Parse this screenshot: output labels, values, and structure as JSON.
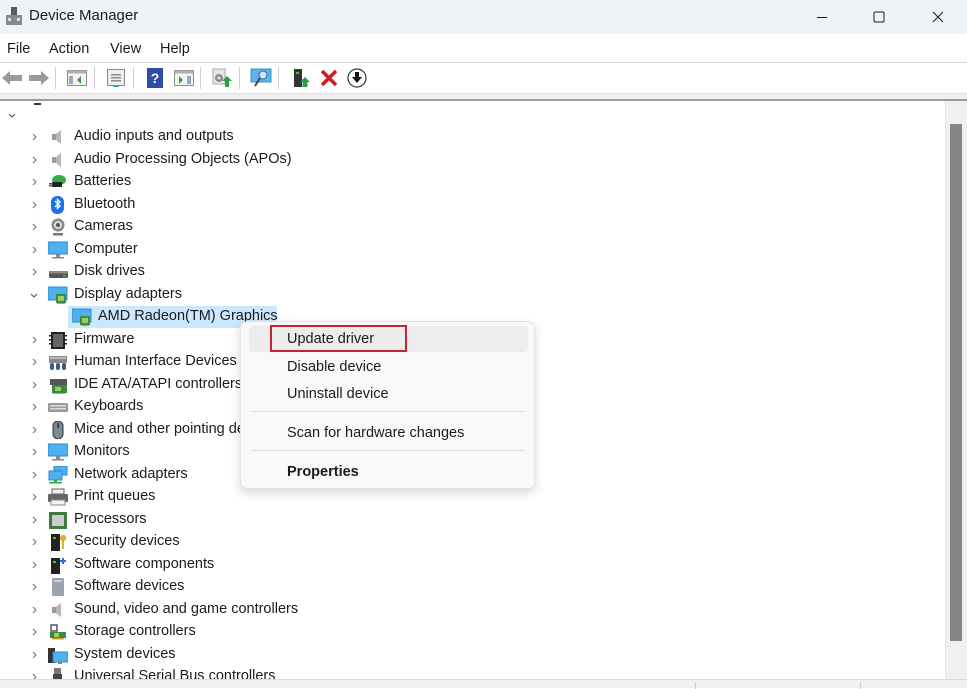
{
  "window": {
    "title": "Device Manager",
    "icon": "device-manager-icon",
    "controls": [
      "minimize-icon",
      "maximize-icon",
      "close-icon"
    ]
  },
  "menubar": {
    "items": [
      {
        "label": "File"
      },
      {
        "label": "Action"
      },
      {
        "label": "View"
      },
      {
        "label": "Help"
      }
    ]
  },
  "toolbar": {
    "buttons": [
      {
        "icon": "back-arrow-icon",
        "name": "back"
      },
      {
        "icon": "forward-arrow-icon",
        "name": "forward"
      },
      {
        "icon": "show-hide-console-tree-icon",
        "name": "show-hide-console-tree"
      },
      {
        "icon": "properties-sheet-icon",
        "name": "properties"
      },
      {
        "icon": "help-icon",
        "name": "help"
      },
      {
        "icon": "show-hide-action-pane-icon",
        "name": "show-hide-action-pane"
      },
      {
        "icon": "update-driver-icon",
        "name": "update-driver"
      },
      {
        "icon": "scan-hardware-changes-icon",
        "name": "scan-hardware"
      },
      {
        "icon": "enable-device-icon",
        "name": "enable-device"
      },
      {
        "icon": "uninstall-device-icon",
        "name": "uninstall-device"
      },
      {
        "icon": "download-driver-icon",
        "name": "disable-device"
      }
    ]
  },
  "tree": {
    "root_expanded": true,
    "categories": [
      {
        "label": "Audio inputs and outputs",
        "icon": "speaker-icon",
        "expanded": false
      },
      {
        "label": "Audio Processing Objects (APOs)",
        "icon": "speaker-icon",
        "expanded": false
      },
      {
        "label": "Batteries",
        "icon": "battery-icon",
        "expanded": false
      },
      {
        "label": "Bluetooth",
        "icon": "bluetooth-icon",
        "expanded": false
      },
      {
        "label": "Cameras",
        "icon": "camera-icon",
        "expanded": false
      },
      {
        "label": "Computer",
        "icon": "computer-icon",
        "expanded": false
      },
      {
        "label": "Disk drives",
        "icon": "disk-drive-icon",
        "expanded": false
      },
      {
        "label": "Display adapters",
        "icon": "display-adapter-icon",
        "expanded": true,
        "children": [
          {
            "label": "AMD Radeon(TM) Graphics",
            "icon": "display-adapter-icon",
            "selected": true
          }
        ]
      },
      {
        "label": "Firmware",
        "icon": "firmware-chip-icon",
        "expanded": false
      },
      {
        "label": "Human Interface Devices",
        "icon": "hid-icon",
        "expanded": false
      },
      {
        "label": "IDE ATA/ATAPI controllers",
        "icon": "ide-controller-icon",
        "expanded": false
      },
      {
        "label": "Keyboards",
        "icon": "keyboard-icon",
        "expanded": false
      },
      {
        "label": "Mice and other pointing devices",
        "icon": "mouse-icon",
        "expanded": false
      },
      {
        "label": "Monitors",
        "icon": "monitor-icon",
        "expanded": false
      },
      {
        "label": "Network adapters",
        "icon": "network-adapter-icon",
        "expanded": false
      },
      {
        "label": "Print queues",
        "icon": "printer-icon",
        "expanded": false
      },
      {
        "label": "Processors",
        "icon": "processor-icon",
        "expanded": false
      },
      {
        "label": "Security devices",
        "icon": "security-key-icon",
        "expanded": false
      },
      {
        "label": "Software components",
        "icon": "software-component-icon",
        "expanded": false
      },
      {
        "label": "Software devices",
        "icon": "software-device-icon",
        "expanded": false
      },
      {
        "label": "Sound, video and game controllers",
        "icon": "speaker-icon",
        "expanded": false
      },
      {
        "label": "Storage controllers",
        "icon": "storage-controller-icon",
        "expanded": false
      },
      {
        "label": "System devices",
        "icon": "system-devices-icon",
        "expanded": false
      },
      {
        "label": "Universal Serial Bus controllers",
        "icon": "usb-icon",
        "expanded": false
      }
    ]
  },
  "context_menu": {
    "items": [
      {
        "label": "Update driver",
        "hovered": true,
        "highlighted": true
      },
      {
        "label": "Disable device"
      },
      {
        "label": "Uninstall device"
      },
      {
        "separator": true
      },
      {
        "label": "Scan for hardware changes"
      },
      {
        "separator": true
      },
      {
        "label": "Properties",
        "bold": true
      }
    ]
  },
  "colors": {
    "selection": "#cce8ff",
    "highlight_box": "#c0262d",
    "titlebar": "#eef3f8",
    "scroll_thumb": "#858585"
  }
}
